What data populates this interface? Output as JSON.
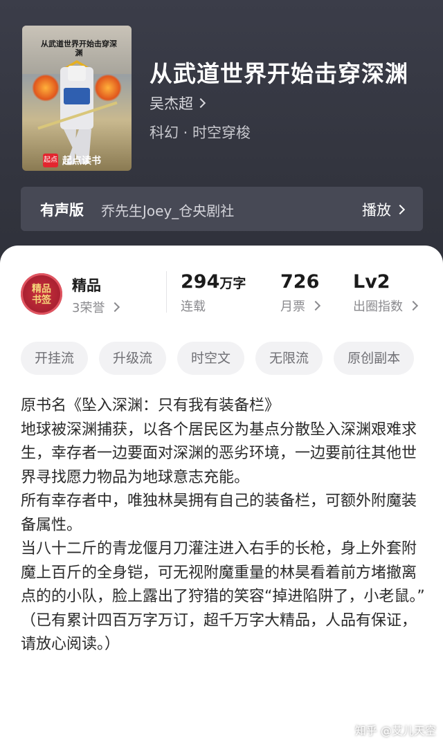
{
  "book": {
    "cover_title": "从武道世界开始击穿深渊",
    "cover_brand": "起点读书",
    "cover_logo": "起点",
    "title": "从武道世界开始击穿深渊",
    "author": "吴杰超",
    "genre": "科幻 · 时空穿梭"
  },
  "audio": {
    "label": "有声版",
    "narrator": "乔先生Joey_仓央剧社",
    "play_label": "播放"
  },
  "stats": {
    "medal_text_line1": "精品",
    "medal_text_line2": "书签",
    "quality_label": "精品",
    "honor_label": "3荣誉",
    "word_count": "294",
    "word_unit": "万字",
    "status": "连载",
    "monthly_votes": "726",
    "monthly_votes_label": "月票",
    "level": "Lv2",
    "level_label": "出圈指数"
  },
  "tags": [
    "开挂流",
    "升级流",
    "时空文",
    "无限流",
    "原创副本"
  ],
  "description": [
    "原书名《坠入深渊：只有我有装备栏》",
    "地球被深渊捕获，以各个居民区为基点分散坠入深渊艰难求生，幸存者一边要面对深渊的恶劣环境，一边要前往其他世界寻找愿力物品为地球意志充能。",
    "所有幸存者中，唯独林昊拥有自己的装备栏，可额外附魔装备属性。",
    "当八十二斤的青龙偃月刀灌注进入右手的长枪，身上外套附魔上百斤的全身铠，可无视附魔重量的林昊看着前方堵撤离点的的小队，脸上露出了狩猎的笑容“掉进陷阱了，小老鼠。”",
    "（已有累计四百万字万订，超千万字大精品，人品有保证，请放心阅读。）"
  ],
  "watermark": "知乎 @艾儿天空",
  "colors": {
    "hero_bg": "#373944",
    "audio_bar": "#474955",
    "medal": "#a61f30",
    "tag_bg": "#f2f2f4"
  }
}
